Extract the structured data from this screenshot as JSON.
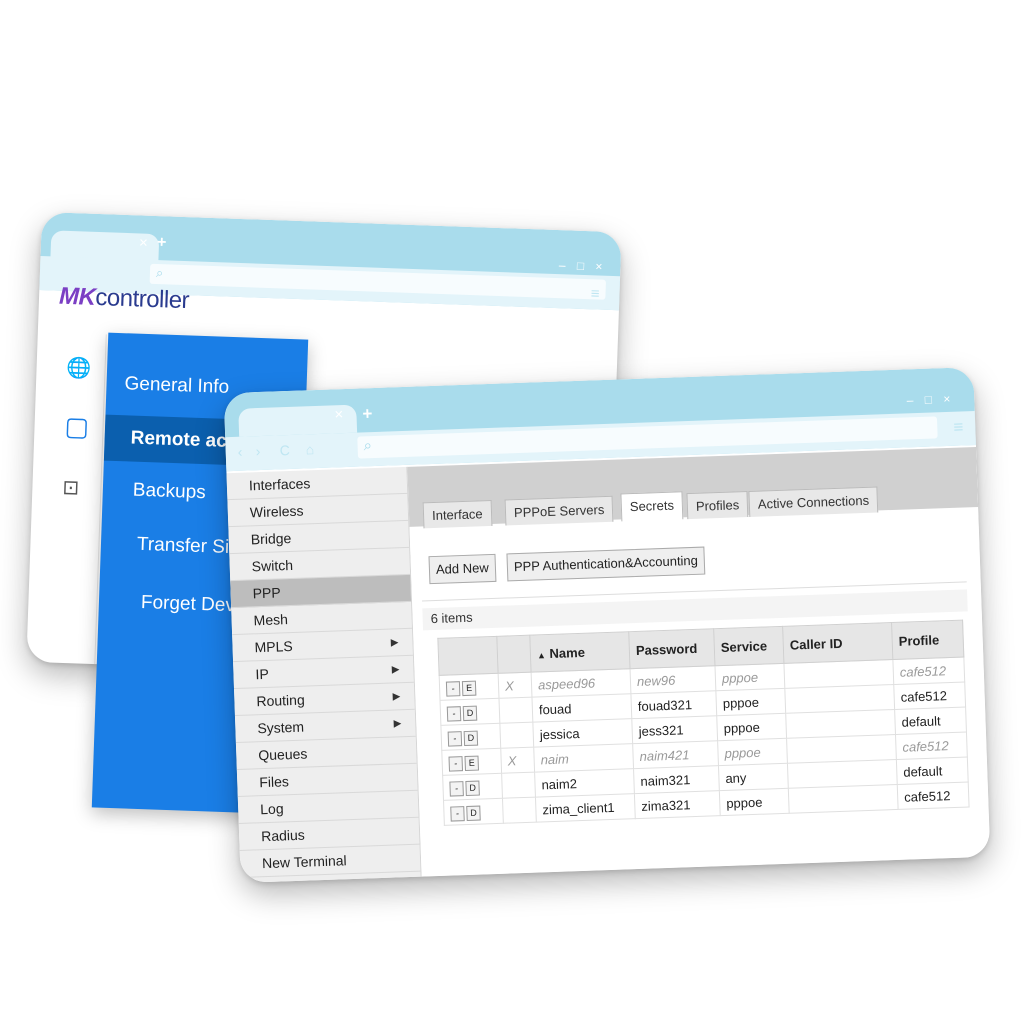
{
  "back_window": {
    "tab_close": "×",
    "new_tab": "+",
    "window_controls": "– □ ×",
    "logo_mark": "MK",
    "logo_text": "controller"
  },
  "blue_menu": {
    "items": [
      "General Info",
      "Remote acc",
      "Backups",
      "Transfer Sit",
      "Forget Devi"
    ],
    "active_index": 1,
    "color": "#1a7ee6"
  },
  "front_window": {
    "tab_close": "×",
    "new_tab": "+",
    "window_controls": "– □ ×",
    "nav": {
      "back": "‹",
      "forward": "›",
      "reload": "C",
      "home": "⌂"
    }
  },
  "sidebar": {
    "items": [
      {
        "label": "Interfaces"
      },
      {
        "label": "Wireless"
      },
      {
        "label": "Bridge"
      },
      {
        "label": "Switch"
      },
      {
        "label": "PPP",
        "selected": true
      },
      {
        "label": "Mesh"
      },
      {
        "label": "MPLS",
        "submenu": true
      },
      {
        "label": "IP",
        "submenu": true
      },
      {
        "label": "Routing",
        "submenu": true
      },
      {
        "label": "System",
        "submenu": true
      },
      {
        "label": "Queues"
      },
      {
        "label": "Files"
      },
      {
        "label": "Log"
      },
      {
        "label": "Radius"
      },
      {
        "label": "New Terminal"
      }
    ],
    "submenu_arrow": "▶"
  },
  "tabs": [
    "Interface",
    "PPPoE Servers",
    "Secrets",
    "Profiles",
    "Active Connections"
  ],
  "active_tab": "Secrets",
  "buttons": {
    "add_new": "Add New",
    "auth": "PPP Authentication&Accounting"
  },
  "items_count": "6 items",
  "table": {
    "sort_indicator": "▲",
    "headers": {
      "name": "Name",
      "password": "Password",
      "service": "Service",
      "caller_id": "Caller ID",
      "profile": "Profile"
    },
    "rows": [
      {
        "ctrl": "E",
        "disabled": true,
        "flag": "X",
        "name": "aspeed96",
        "password": "new96",
        "service": "pppoe",
        "caller_id": "",
        "profile": "cafe512"
      },
      {
        "ctrl": "D",
        "disabled": false,
        "flag": "",
        "name": "fouad",
        "password": "fouad321",
        "service": "pppoe",
        "caller_id": "",
        "profile": "cafe512"
      },
      {
        "ctrl": "D",
        "disabled": false,
        "flag": "",
        "name": "jessica",
        "password": "jess321",
        "service": "pppoe",
        "caller_id": "",
        "profile": "default"
      },
      {
        "ctrl": "E",
        "disabled": true,
        "flag": "X",
        "name": "naim",
        "password": "naim421",
        "service": "pppoe",
        "caller_id": "",
        "profile": "cafe512"
      },
      {
        "ctrl": "D",
        "disabled": false,
        "flag": "",
        "name": "naim2",
        "password": "naim321",
        "service": "any",
        "caller_id": "",
        "profile": "default"
      },
      {
        "ctrl": "D",
        "disabled": false,
        "flag": "",
        "name": "zima_client1",
        "password": "zima321",
        "service": "pppoe",
        "caller_id": "",
        "profile": "cafe512"
      }
    ],
    "remove_label": "-"
  },
  "colors": {
    "chrome": "#a9dcec",
    "accent_blue": "#1a7ee6",
    "logo_purple": "#7b3fc4"
  }
}
